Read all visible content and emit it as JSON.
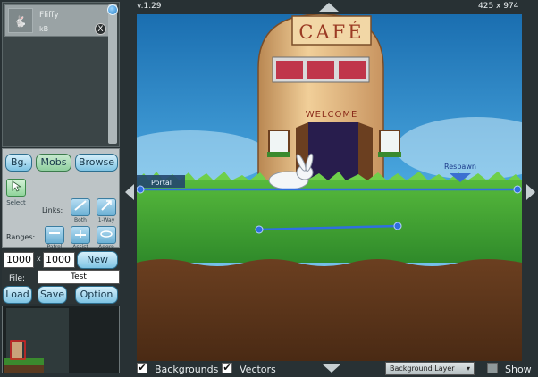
{
  "version": "v.1.29",
  "dimensions": "425 x 974",
  "asset": {
    "name": "Fliffy",
    "size": "kB",
    "close": "X"
  },
  "buttons": {
    "bg": "Bg.",
    "mobs": "Mobs",
    "browse": "Browse",
    "new": "New",
    "load": "Load",
    "save": "Save",
    "option": "Option"
  },
  "labels": {
    "select": "Select",
    "links": "Links:",
    "ranges": "Ranges:",
    "file": "File:",
    "times": "x"
  },
  "links": {
    "both": "Both",
    "oneway": "1-Way"
  },
  "ranges": {
    "patrol": "Patrol",
    "assist": "Assist",
    "aggro": "Aggro"
  },
  "size_inputs": {
    "width": "1000",
    "height": "1000"
  },
  "file_value": "Test",
  "scene": {
    "cafe_sign": "CAFÉ",
    "welcome": "WELCOME",
    "portal": "Portal",
    "respawn": "Respawn"
  },
  "bottom": {
    "backgrounds": "Backgrounds",
    "vectors": "Vectors",
    "layer": "Background Layer",
    "show": "Show",
    "check": "✔"
  },
  "colors": {
    "vector": "#2f6fe0",
    "accent": "#1f7cc7",
    "panel": "#283134"
  }
}
